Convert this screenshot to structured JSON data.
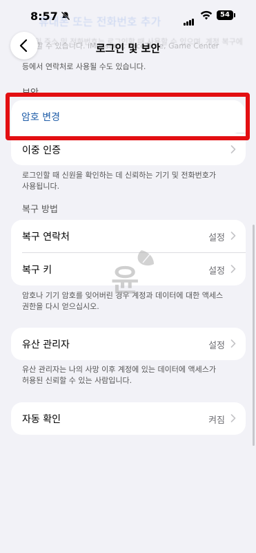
{
  "status_bar": {
    "time": "8:57",
    "battery": "54"
  },
  "background_header": {
    "title": "휴대폰 또는 전화번호 추가",
    "line1": "이메일 주소 및 전화번호는 로그인할 때 사용할 수 있으며, 계정 복구에",
    "line2": "사용할 수 있습니다. iMessage, FaceTime, Game Center",
    "line3": "등에서 연락처로 사용될 수도 있습니다."
  },
  "nav": {
    "title": "로그인 및 보안"
  },
  "security_section": {
    "header": "보안",
    "change_password": "암호 변경",
    "two_factor": "이중 인증",
    "footnote_line1": "로그인할 때 신원을 확인하는 데 신뢰하는 기기 및 전화번호가",
    "footnote_line2": "사용됩니다."
  },
  "recovery_section": {
    "header": "복구 방법",
    "items": [
      {
        "label": "복구 연락처",
        "value": "설정"
      },
      {
        "label": "복구 키",
        "value": "설정"
      }
    ],
    "footnote_line1": "암호나 기기 암호를 잊어버린 경우 계정과 데이터에 대한 액세스",
    "footnote_line2": "권한을 다시 얻으십시오."
  },
  "legacy_section": {
    "label": "유산 관리자",
    "value": "설정",
    "footnote_line1": "유산 관리자는 나의 사망 이후 계정에 있는 데이터에 액세스가",
    "footnote_line2": "허용된 신뢰할 수 있는 사람입니다."
  },
  "auto_verify": {
    "label": "자동 확인",
    "value": "켜짐"
  },
  "watermark": {
    "text": "윤"
  },
  "colors": {
    "highlight": "#e30f12",
    "link": "#1f5da8",
    "background": "#f2f2f7"
  }
}
